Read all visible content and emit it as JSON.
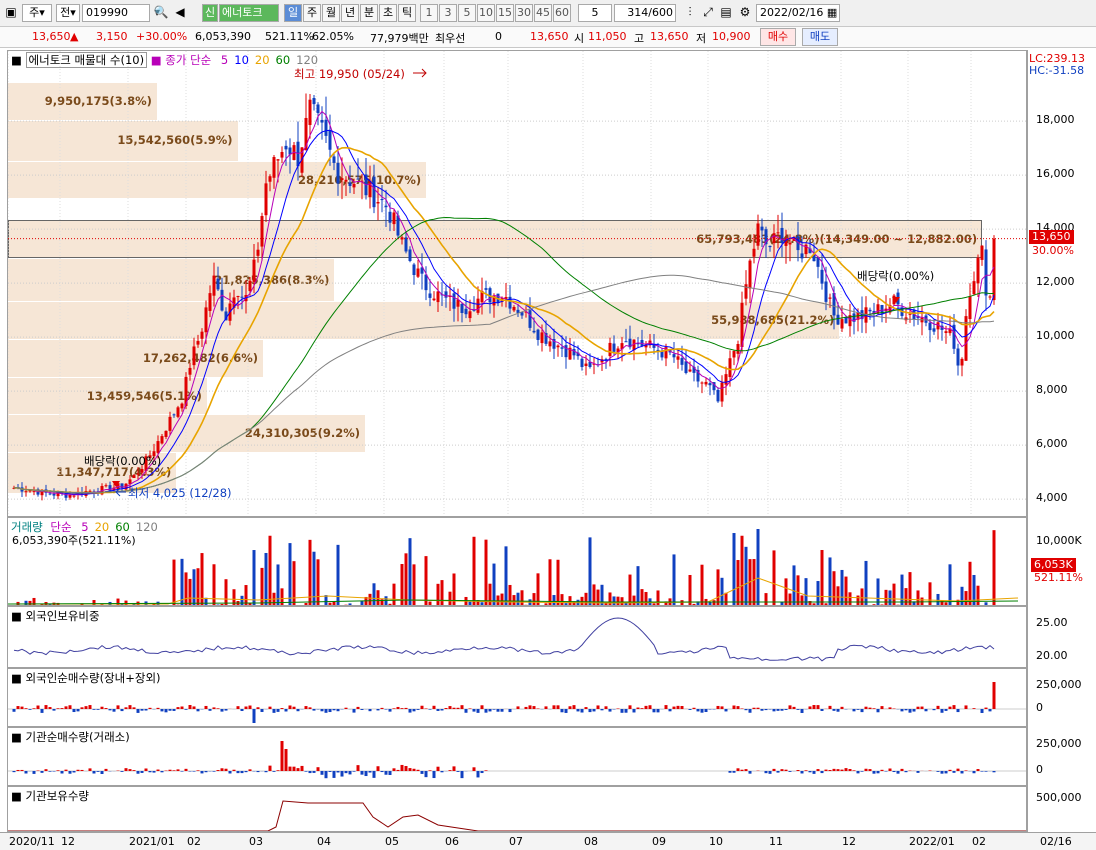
{
  "toolbar": {
    "period_sel": "주",
    "sel2": "전",
    "code": "019990",
    "stock_name": "에너토크",
    "credit": "신",
    "period_tabs": [
      "일",
      "주",
      "월",
      "년",
      "분",
      "초",
      "틱"
    ],
    "min_units": [
      "1",
      "3",
      "5",
      "10",
      "15",
      "30",
      "45",
      "60"
    ],
    "unit_val": "5",
    "count": "314",
    "count_total": "/600",
    "date": "2022/02/16"
  },
  "quote": {
    "price": "13,650",
    "change": "3,150",
    "rate": "+30.00%",
    "volume": "6,053,390",
    "vol_rate": "521.11%",
    "turnover": "62.05%",
    "amount": "77,979백만",
    "pref_label": "최우선",
    "pref_val": "0",
    "bid": "13,650",
    "open_label": "시",
    "open": "11,050",
    "high_label": "고",
    "high": "13,650",
    "low_label": "저",
    "low": "10,900",
    "buy": "매수",
    "sell": "매도"
  },
  "price_pane": {
    "title": "에너토크 매물대 수(10)",
    "ma_label": "종가 단순",
    "ma": [
      {
        "p": "5",
        "c": "#b800b8"
      },
      {
        "p": "10",
        "c": "#0000ff"
      },
      {
        "p": "20",
        "c": "#e8a400"
      },
      {
        "p": "60",
        "c": "#008000"
      },
      {
        "p": "120",
        "c": "#808080"
      }
    ],
    "lc": "LC:239.13",
    "hc": "HC:-31.58",
    "high_note": "최고 19,950 (05/24)",
    "low_note": "최저 4,025 (12/28)",
    "div1": "배당락(0.00%)",
    "div2": "배당락(0.00%)",
    "yticks": [
      "18,000",
      "16,000",
      "14,000",
      "12,000",
      "10,000",
      "8,000",
      "6,000",
      "4,000"
    ],
    "cur_tag": "13,650",
    "cur_pct": "30.00%",
    "volume_profile": [
      {
        "label": "9,950,175(3.8%)",
        "lo": 18000,
        "hi": 19400,
        "w": 0.146
      },
      {
        "label": "15,542,560(5.9%)",
        "lo": 16500,
        "hi": 18000,
        "w": 0.225
      },
      {
        "label": "28,210,575(10.7%)",
        "lo": 15100,
        "hi": 16500,
        "w": 0.41
      },
      {
        "label": "65,793,483(24.8%)(14,349.00 ~ 12,882.00)",
        "lo": 12882,
        "hi": 14349,
        "w": 0.955
      },
      {
        "label": "21,825,386(8.3%)",
        "lo": 11300,
        "hi": 12882,
        "w": 0.32
      },
      {
        "label": "55,988,685(21.2%)",
        "lo": 9900,
        "hi": 11300,
        "w": 0.815
      },
      {
        "label": "17,262,482(6.6%)",
        "lo": 8500,
        "hi": 9900,
        "w": 0.25
      },
      {
        "label": "13,459,546(5.1%)",
        "lo": 7100,
        "hi": 8500,
        "w": 0.195
      },
      {
        "label": "24,310,305(9.2%)",
        "lo": 5700,
        "hi": 7100,
        "w": 0.35
      },
      {
        "label": "11,347,717(4.3%)",
        "lo": 4200,
        "hi": 5700,
        "w": 0.165
      }
    ]
  },
  "volume_pane": {
    "title": "거래량",
    "ma_label": "단순",
    "ma": [
      "5",
      "20",
      "60",
      "120"
    ],
    "sub": "6,053,390주(521.11%)",
    "yticks": [
      "10,000K"
    ],
    "cur_tag": "6,053K",
    "cur_pct": "521.11%"
  },
  "foreign_ratio": {
    "title": "외국인보유비중",
    "yticks": [
      "25.00",
      "20.00"
    ]
  },
  "foreign_net": {
    "title": "외국인순매수량(장내+장외)",
    "yticks": [
      "250,000",
      "0"
    ]
  },
  "inst_net": {
    "title": "기관순매수량(거래소)",
    "yticks": [
      "250,000",
      "0"
    ]
  },
  "inst_hold": {
    "title": "기관보유수량",
    "yticks": [
      "500,000"
    ]
  },
  "xaxis": {
    "labels": [
      "2020/11",
      "12",
      "2021/01",
      "02",
      "03",
      "04",
      "05",
      "06",
      "07",
      "08",
      "09",
      "10",
      "11",
      "12",
      "2022/01",
      "02"
    ],
    "right": "02/16"
  },
  "colors": {
    "up": "#e00000",
    "down": "#1040c0"
  }
}
